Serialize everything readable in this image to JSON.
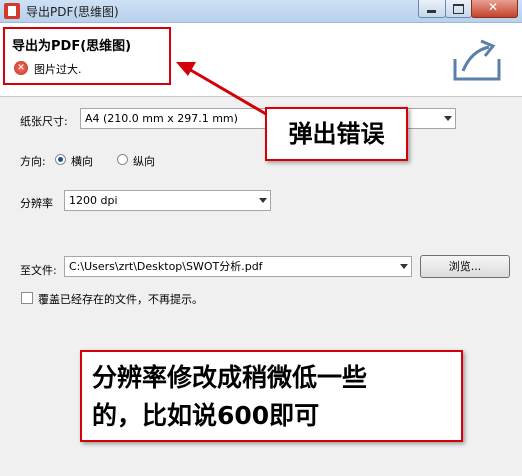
{
  "window": {
    "title": "导出PDF(思维图)"
  },
  "header": {
    "title": "导出为PDF(思维图)",
    "error_text": "图片过大."
  },
  "form": {
    "paper_label": "纸张尺寸:",
    "paper_value": "A4 (210.0 mm x 297.1 mm)",
    "orientation_label": "方向:",
    "orientation_landscape": "横向",
    "orientation_portrait": "纵向",
    "orientation_selected": "横向",
    "resolution_label": "分辨率",
    "resolution_value": "1200 dpi",
    "file_label": "至文件:",
    "file_value": "C:\\Users\\zrt\\Desktop\\SWOT分析.pdf",
    "browse_label": "浏览...",
    "overwrite_label": "覆盖已经存在的文件，不再提示。"
  },
  "annotations": {
    "popup_error": "弹出错误",
    "advice_line1": "分辨率修改成稍微低一些",
    "advice_line2": "的，比如说600即可"
  },
  "colors": {
    "annotation_red": "#d4000a"
  }
}
